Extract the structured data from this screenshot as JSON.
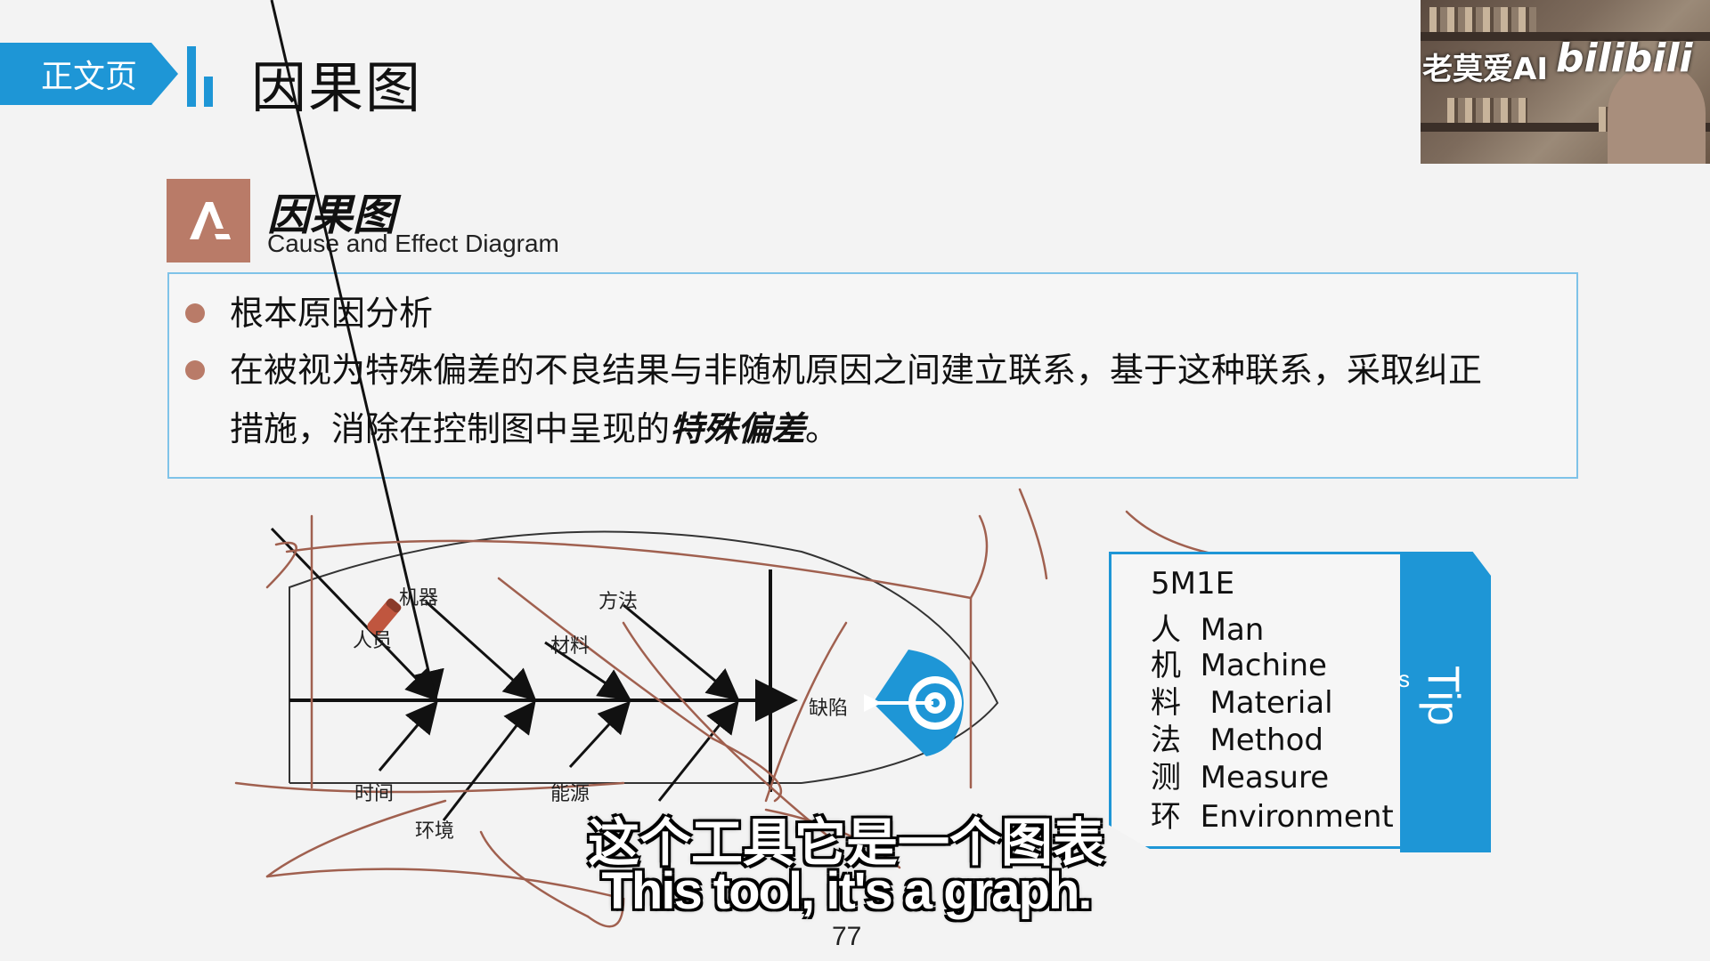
{
  "header": {
    "tab_label": "正文页",
    "title": "因果图"
  },
  "webcam": {
    "channel_name": "老莫爱AI",
    "platform_logo": "bilibili"
  },
  "section": {
    "badge_icon": "letter-a-logo-icon",
    "title_zh": "因果图",
    "title_en": "Cause and Effect Diagram"
  },
  "content": {
    "bullet_1": "根本原因分析",
    "bullet_2_line_1": "在被视为特殊偏差的不良结果与非随机原因之间建立联系，基于这种联系，采取纠正",
    "bullet_2_line_2_plain": "措施，消除在控制图中呈现的",
    "bullet_2_line_2_emph": "特殊偏差",
    "bullet_2_line_2_end": "。"
  },
  "fishbone": {
    "labels": {
      "machine": "机器",
      "method": "方法",
      "personnel": "人员",
      "material": "材料",
      "defect": "缺陷",
      "time": "时间",
      "energy": "能源",
      "environment": "环境"
    },
    "head_icon": "target-arrow-icon"
  },
  "tips": {
    "band_label": "Tip",
    "band_label_cut": "s",
    "heading": "5M1E",
    "items": [
      {
        "zh": "人",
        "en": "Man"
      },
      {
        "zh": "机",
        "en": "Machine"
      },
      {
        "zh": "料",
        "en": "Material"
      },
      {
        "zh": "法",
        "en": "Method"
      },
      {
        "zh": "测",
        "en": "Measure"
      },
      {
        "zh": "环",
        "en": "Environment"
      }
    ]
  },
  "subtitles": {
    "zh": "这个工具它是一个图表",
    "en": "This tool, it's a graph."
  },
  "page_number": "77",
  "colors": {
    "accent_blue": "#1e96d6",
    "accent_brown": "#b97b68",
    "ink_annotation": "#a0604f"
  }
}
